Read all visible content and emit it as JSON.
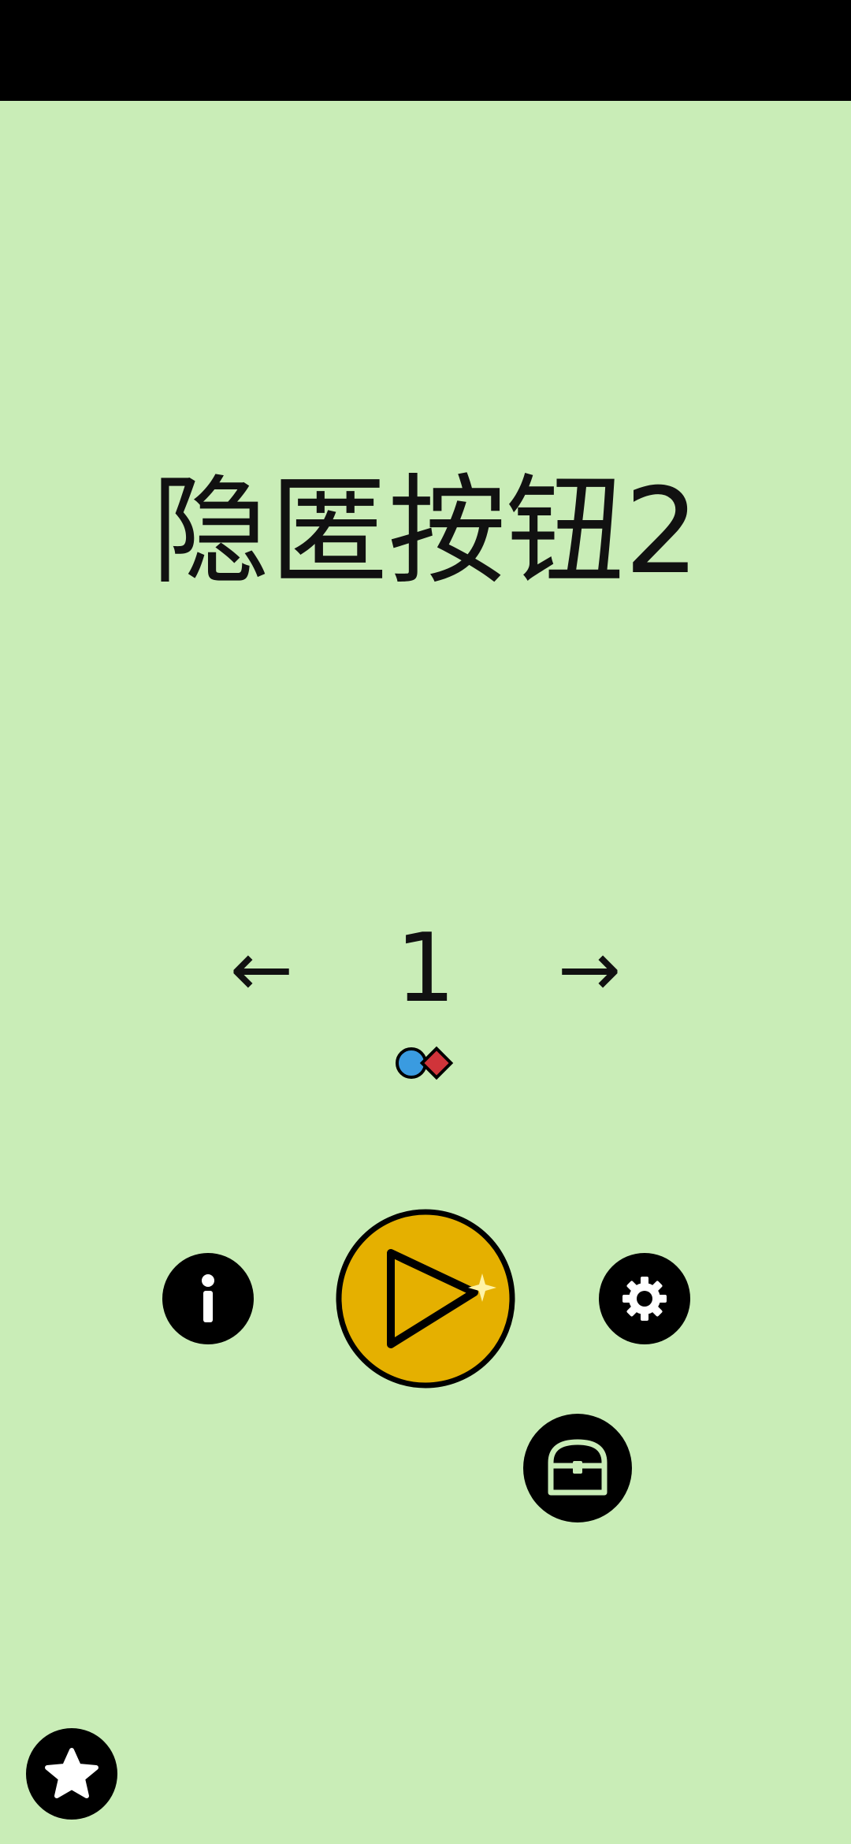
{
  "title": "隐匿按钮2",
  "level": {
    "number": "1",
    "prev_label": "←",
    "next_label": "→"
  },
  "buttons": {
    "info_icon": "info-icon",
    "play_icon": "play-icon",
    "settings_icon": "gear-icon",
    "chest_icon": "treasure-chest-icon",
    "star_icon": "star-icon"
  },
  "colors": {
    "background": "#c9edb7",
    "play_button": "#e5b000",
    "circle_shape": "#3a9be0",
    "diamond_shape": "#d0343a"
  }
}
